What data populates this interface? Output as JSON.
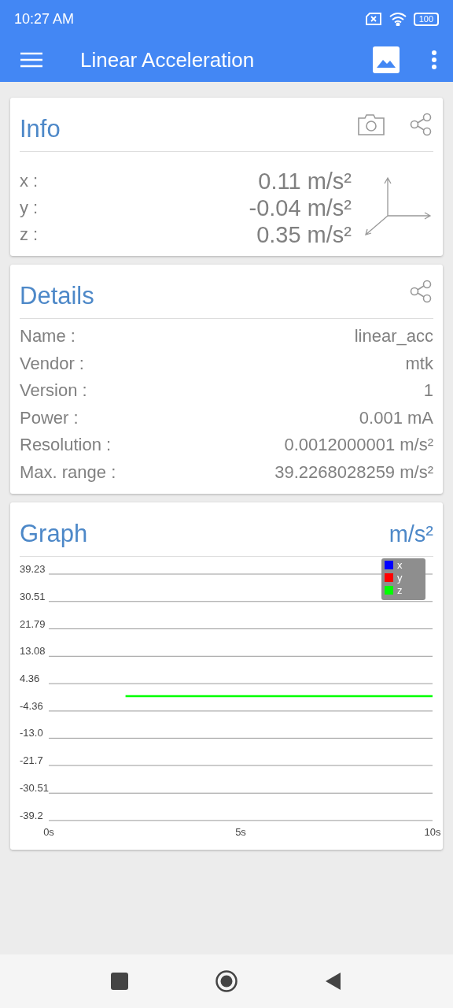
{
  "status_bar": {
    "time": "10:27 AM",
    "battery": "100"
  },
  "app_bar": {
    "title": "Linear Acceleration"
  },
  "info": {
    "title": "Info",
    "rows": [
      {
        "label": "x :",
        "value": "0.11 m/s²"
      },
      {
        "label": "y :",
        "value": "-0.04 m/s²"
      },
      {
        "label": "z :",
        "value": "0.35 m/s²"
      }
    ]
  },
  "details": {
    "title": "Details",
    "rows": [
      {
        "label": "Name :",
        "value": "linear_acc"
      },
      {
        "label": "Vendor :",
        "value": "mtk"
      },
      {
        "label": "Version :",
        "value": "1"
      },
      {
        "label": "Power :",
        "value": "0.001 mA"
      },
      {
        "label": "Resolution :",
        "value": "0.0012000001 m/s²"
      },
      {
        "label": "Max. range :",
        "value": "39.2268028259 m/s²"
      }
    ]
  },
  "graph": {
    "title": "Graph",
    "unit": "m/s²",
    "chart_data": {
      "type": "line",
      "x": [
        2,
        10
      ],
      "xlim": [
        0,
        10
      ],
      "ylim": [
        -39.23,
        39.23
      ],
      "grid": true,
      "legend": true,
      "xticks": [
        {
          "value": 0,
          "label": "0s"
        },
        {
          "value": 5,
          "label": "5s"
        },
        {
          "value": 10,
          "label": "10s"
        }
      ],
      "yticks": [
        {
          "value": 39.23,
          "label": "39.23"
        },
        {
          "value": 30.51,
          "label": "30.51"
        },
        {
          "value": 21.79,
          "label": "21.79"
        },
        {
          "value": 13.08,
          "label": "13.08"
        },
        {
          "value": 4.36,
          "label": "4.36"
        },
        {
          "value": -4.36,
          "label": "-4.36"
        },
        {
          "value": -13.0,
          "label": "-13.0"
        },
        {
          "value": -21.7,
          "label": "-21.7"
        },
        {
          "value": -30.51,
          "label": "-30.51"
        },
        {
          "value": -39.2,
          "label": "-39.2"
        }
      ],
      "series": [
        {
          "name": "x",
          "color": "#0000ff",
          "values": [
            null,
            null
          ]
        },
        {
          "name": "y",
          "color": "#ff0000",
          "values": [
            null,
            null
          ]
        },
        {
          "name": "z",
          "color": "#00ff00",
          "values": [
            0.4,
            0.4
          ]
        }
      ]
    }
  }
}
